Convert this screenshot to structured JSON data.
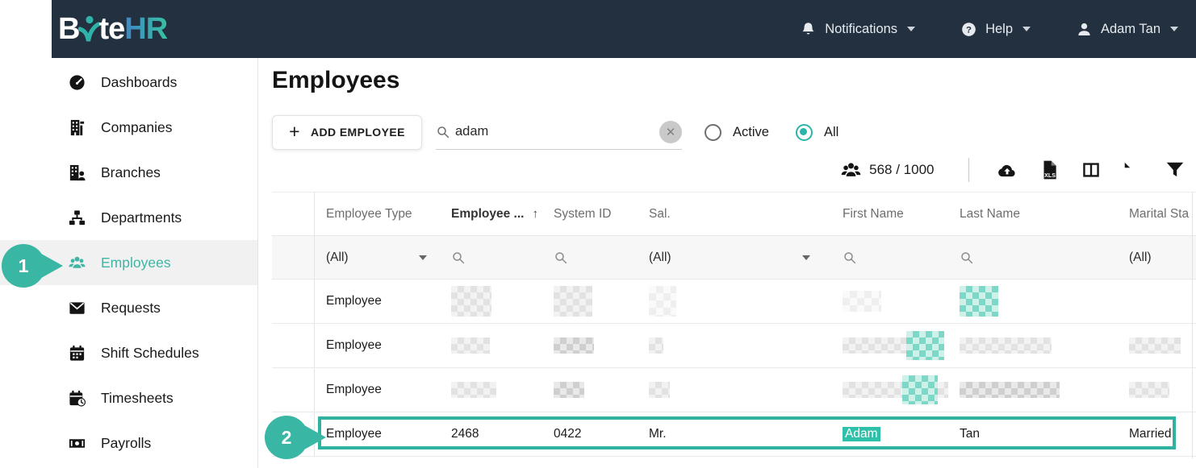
{
  "topbar": {
    "logo": {
      "part1": "B",
      "part2": "te",
      "part3": "HR"
    },
    "notifications_label": "Notifications",
    "help_label": "Help",
    "user_name": "Adam Tan"
  },
  "sidebar": {
    "items": [
      {
        "label": "Dashboards",
        "icon": "gauge",
        "active": false
      },
      {
        "label": "Companies",
        "icon": "building",
        "active": false
      },
      {
        "label": "Branches",
        "icon": "building-user",
        "active": false
      },
      {
        "label": "Departments",
        "icon": "org-chart",
        "active": false
      },
      {
        "label": "Employees",
        "icon": "people",
        "active": true
      },
      {
        "label": "Requests",
        "icon": "envelope",
        "active": false
      },
      {
        "label": "Shift Schedules",
        "icon": "calendar",
        "active": false
      },
      {
        "label": "Timesheets",
        "icon": "calendar-clock",
        "active": false
      },
      {
        "label": "Payrolls",
        "icon": "banknote",
        "active": false
      }
    ]
  },
  "main": {
    "title": "Employees",
    "add_button_label": "ADD EMPLOYEE",
    "search": {
      "value": "adam"
    },
    "radios": [
      {
        "label": "Active",
        "checked": false
      },
      {
        "label": "All",
        "checked": true
      }
    ],
    "counter": "568 / 1000",
    "toolbar_icons": [
      "upload-cloud",
      "export-xls",
      "column-chooser",
      "refresh",
      "filter"
    ]
  },
  "table": {
    "columns": [
      {
        "label": ""
      },
      {
        "label": "Employee Type"
      },
      {
        "label": "Employee ...",
        "sorted": "asc"
      },
      {
        "label": "System ID"
      },
      {
        "label": "Sal."
      },
      {
        "label": "First Name"
      },
      {
        "label": "Last Name"
      },
      {
        "label": "Marital Sta"
      }
    ],
    "filters": [
      {
        "type": "none"
      },
      {
        "type": "select",
        "value": "(All)"
      },
      {
        "type": "search"
      },
      {
        "type": "search"
      },
      {
        "type": "select",
        "value": "(All)"
      },
      {
        "type": "search"
      },
      {
        "type": "search"
      },
      {
        "type": "select-plain",
        "value": "(All)"
      }
    ],
    "rows": [
      {
        "highlighted": false,
        "cells": [
          {},
          {
            "text": "Employee"
          },
          {
            "blocks": [
              [
                "gray",
                50,
                38
              ]
            ]
          },
          {
            "blocks": [
              [
                "gray",
                48,
                38
              ]
            ]
          },
          {
            "blocks": [
              [
                "gray-light",
                34,
                38
              ]
            ]
          },
          {
            "blocks": [
              [
                "gray-light",
                48,
                26
              ]
            ]
          },
          {
            "blocks": [
              [
                "teal",
                48,
                38
              ]
            ]
          },
          {}
        ]
      },
      {
        "highlighted": false,
        "cells": [
          {},
          {
            "text": "Employee"
          },
          {
            "blocks": [
              [
                "gray",
                48,
                20
              ]
            ]
          },
          {
            "blocks": [
              [
                "gray-dark",
                50,
                20
              ]
            ]
          },
          {
            "blocks": [
              [
                "gray",
                18,
                20
              ]
            ]
          },
          {
            "blocks": [
              [
                "gray",
                79,
                20
              ],
              [
                "teal",
                47,
                36
              ]
            ]
          },
          {
            "blocks": [
              [
                "gray",
                114,
                20
              ]
            ]
          },
          {
            "blocks": [
              [
                "gray",
                64,
                20
              ]
            ]
          }
        ]
      },
      {
        "highlighted": false,
        "cells": [
          {},
          {
            "text": "Employee"
          },
          {
            "blocks": [
              [
                "gray",
                56,
                20
              ]
            ]
          },
          {
            "blocks": [
              [
                "gray-dark",
                38,
                20
              ]
            ]
          },
          {
            "blocks": [
              [
                "gray",
                26,
                20
              ]
            ]
          },
          {
            "blocks": [
              [
                "gray",
                78,
                20
              ],
              [
                "teal",
                46,
                36
              ],
              [
                "gray",
                14,
                20
              ]
            ]
          },
          {
            "blocks": [
              [
                "gray-dark",
                124,
                20
              ]
            ]
          },
          {
            "blocks": [
              [
                "gray",
                50,
                20
              ]
            ]
          }
        ]
      },
      {
        "highlighted": true,
        "cells": [
          {},
          {
            "text": "Employee"
          },
          {
            "text": "2468"
          },
          {
            "text": "0422"
          },
          {
            "text": "Mr."
          },
          {
            "text": "Adam",
            "match": true
          },
          {
            "text": "Tan"
          },
          {
            "text": "Married"
          }
        ]
      }
    ]
  },
  "annotations": [
    {
      "number": "1"
    },
    {
      "number": "2"
    }
  ],
  "colors": {
    "accent": "#38b6a3",
    "topbar_bg": "#22303f",
    "match_bg": "#2ec0a9",
    "highlight_border": "#2fb3a0"
  }
}
